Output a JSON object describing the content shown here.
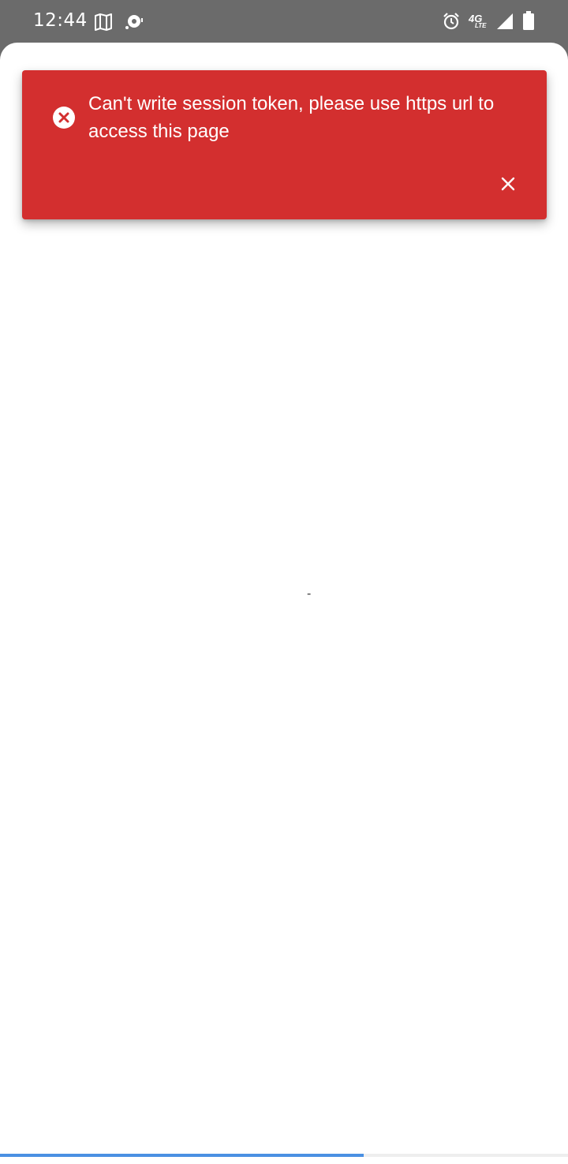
{
  "status_bar": {
    "time": "12:44",
    "icons": [
      "map-icon",
      "cast-icon",
      "alarm-icon",
      "network-4g-lte-icon",
      "signal-icon",
      "battery-icon"
    ],
    "network_type": "4G",
    "network_sub": "LTE"
  },
  "toast": {
    "message": "Can't write session token, please use https url to access this page",
    "icon": "error-circle-icon",
    "close_icon": "close-icon",
    "background": "#d32f2f"
  },
  "content": {
    "placeholder": "-"
  },
  "progress": {
    "value": 0.64,
    "color": "#4a90e2"
  }
}
